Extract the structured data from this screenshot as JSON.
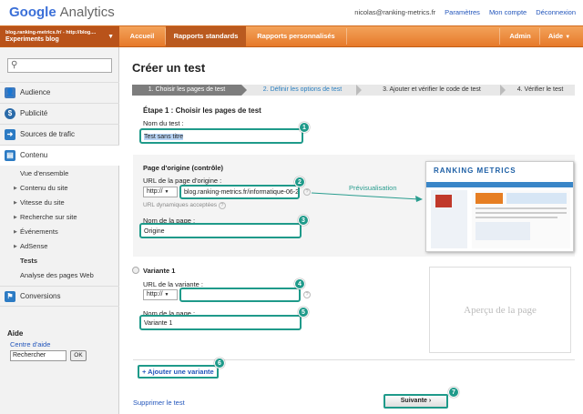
{
  "header": {
    "logo_google": "Google",
    "logo_analytics": "Analytics",
    "email": "nicolas@ranking-metrics.fr",
    "links": [
      "Paramètres",
      "Mon compte",
      "Déconnexion"
    ]
  },
  "nav": {
    "account_line1": "blog.ranking-metrics.fr/ - http://blog....",
    "account_line2": "Experiments blog",
    "tabs": [
      "Accueil",
      "Rapports standards",
      "Rapports personnalisés"
    ],
    "right": [
      "Admin",
      "Aide"
    ]
  },
  "sidebar": {
    "search_placeholder": "",
    "items": [
      "Audience",
      "Publicité",
      "Sources de trafic",
      "Contenu"
    ],
    "sub_items": [
      "Vue d'ensemble",
      "Contenu du site",
      "Vitesse du site",
      "Recherche sur site",
      "Événements",
      "AdSense",
      "Tests",
      "Analyse des pages Web"
    ],
    "conversions": "Conversions",
    "help_title": "Aide",
    "help_link": "Centre d'aide",
    "help_input": "Rechercher",
    "help_ok": "OK"
  },
  "main": {
    "title": "Créer un test",
    "steps": [
      "1. Choisir les pages de test",
      "2. Définir les options de test",
      "3. Ajouter et vérifier le code de test",
      "4. Vérifier le test"
    ],
    "step_heading": "Étape 1 : Choisir les pages de test",
    "test_name_label": "Nom du test :",
    "test_name_value": "Test sans titre",
    "origin_heading": "Page d'origine (contrôle)",
    "origin_url_label": "URL de la page d'origine :",
    "protocol": "http://",
    "origin_url_value": "blog.ranking-metrics.fr/informatique-06-2",
    "dynamic_url_hint": "URL dynamiques acceptées",
    "page_name_label": "Nom de la page :",
    "page_name_value": "Origine",
    "preview_label": "Prévisualisation",
    "thumb_brand": "RANKING METRICS",
    "variant_heading": "Variante 1",
    "variant_url_label": "URL de la variante :",
    "variant_protocol": "http://",
    "variant_url_value": "",
    "variant_name_label": "Nom de la page :",
    "variant_name_value": "Variante 1",
    "page_preview": "Aperçu de la page",
    "add_variant": "+ Ajouter une variante",
    "delete_test": "Supprimer le test",
    "next": "Suivante ›",
    "badges": [
      "1",
      "2",
      "3",
      "4",
      "5",
      "6",
      "7"
    ]
  },
  "colors": {
    "orange": "#e6792a",
    "teal": "#1f9a8a",
    "link": "#2255bb"
  }
}
